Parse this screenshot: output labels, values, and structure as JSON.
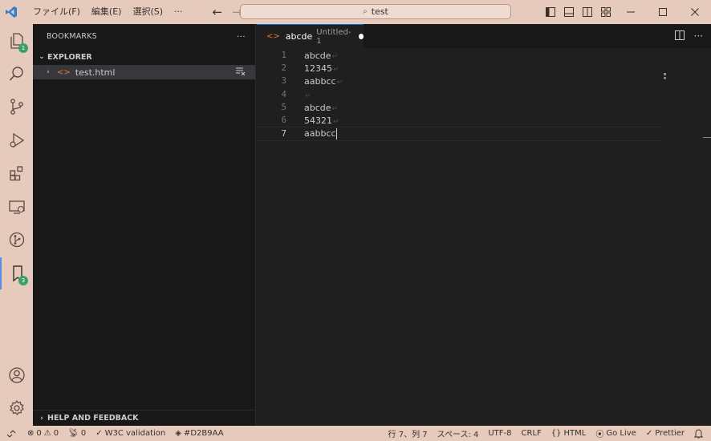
{
  "titlebar": {
    "menus": [
      "ファイル(F)",
      "編集(E)",
      "選択(S)",
      "···"
    ],
    "search_text": "test"
  },
  "activity": {
    "explorer_badge": "1",
    "bookmarks_badge": "3"
  },
  "sidebar": {
    "header": "BOOKMARKS",
    "more": "···",
    "section": "EXPLORER",
    "file": "test.html",
    "bottom_section": "HELP AND FEEDBACK"
  },
  "editor": {
    "tab_name": "abcde",
    "tab_desc": "Untitled-1",
    "lines": [
      {
        "num": "1",
        "text": "abcde"
      },
      {
        "num": "2",
        "text": "12345"
      },
      {
        "num": "3",
        "text": "aabbcc"
      },
      {
        "num": "4",
        "text": ""
      },
      {
        "num": "5",
        "text": "abcde"
      },
      {
        "num": "6",
        "text": "54321"
      },
      {
        "num": "7",
        "text": "aabbcc"
      }
    ],
    "eol_glyph": "↵"
  },
  "statusbar": {
    "errors": "0",
    "warnings": "0",
    "ports": "0",
    "w3c": "W3C validation",
    "color": "#D2B9AA",
    "position": "行 7、列 7",
    "spaces": "スペース: 4",
    "encoding": "UTF-8",
    "eol": "CRLF",
    "language": "HTML",
    "golive": "Go Live",
    "prettier": "Prettier"
  },
  "colors": {
    "chrome": "#e6cbbd",
    "sidebar_bg": "#181818",
    "editor_bg": "#1f1f1f",
    "accent": "#0078d4",
    "badge": "#3d9f67"
  }
}
